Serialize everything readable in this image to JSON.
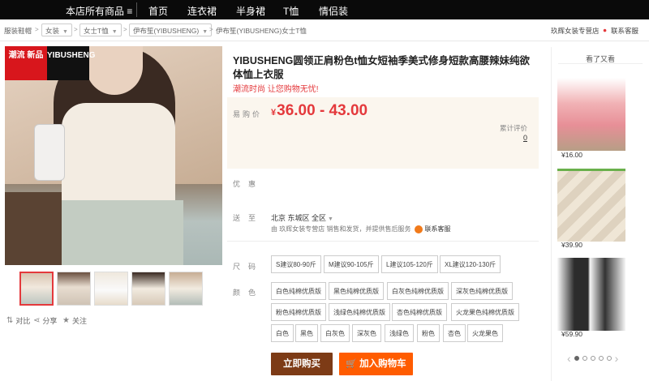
{
  "topbar": {
    "store_all": "本店所有商品 ≡",
    "nav": [
      "首页",
      "连衣裙",
      "半身裙",
      "T恤",
      "情侣装"
    ]
  },
  "breadcrumb": {
    "home": "服装鞋帽",
    "levels": [
      "女装",
      "女士T恤",
      "伊布笙(YIBUSHENG)"
    ],
    "current": "伊布笙(YIBUSHENG)女士T恤",
    "shop_name": "玖辉女装专营店",
    "contact": "联系客服"
  },
  "badge": {
    "left": "潮流 新品",
    "right": "YIBUSHENG"
  },
  "product": {
    "title": "YIBUSHENG圆领正肩粉色t恤女短袖季美式修身短款高腰辣妹纯欲体恤上衣服",
    "slogan": "潮流时尚 让您购物无忧!",
    "price_label": "易购价",
    "currency": "¥",
    "price": "36.00 - 43.00",
    "review_label": "累计评价",
    "review_count": "0",
    "promo_label": "优惠",
    "ship_label": "送至",
    "location": "北京 东城区 全区",
    "shipping_note": "由 玖辉女装专营店 销售和发货，并提供售后服务",
    "contact_service": "联系客服",
    "size_label": "尺码",
    "sizes": [
      "S建议80-90斤",
      "M建议90-105斤",
      "L建议105-120斤",
      "XL建议120-130斤"
    ],
    "color_label": "颜色",
    "colors_row1": [
      "白色纯棉优质版",
      "黑色纯棉优质版",
      "白灰色纯棉优质版",
      "深灰色纯棉优质版"
    ],
    "colors_row2": [
      "粉色纯棉优质版",
      "浅绿色纯棉优质版",
      "杏色纯棉优质版",
      "火龙果色纯棉优质版"
    ],
    "colors_row3": [
      "白色",
      "黑色",
      "白灰色",
      "深灰色",
      "浅绿色",
      "粉色",
      "杏色",
      "火龙果色"
    ],
    "buy_now": "立即购买",
    "add_cart": "加入购物车"
  },
  "actions": {
    "compare": "对比",
    "share": "分享",
    "follow": "关注"
  },
  "sidebar": {
    "title": "看了又看",
    "items": [
      {
        "price": "¥16.00"
      },
      {
        "price": "¥39.90"
      },
      {
        "price": "¥59.90"
      }
    ]
  },
  "colors": {
    "accent": "#e4393c",
    "buy": "#7d3b16",
    "cart": "#ff5c00"
  }
}
